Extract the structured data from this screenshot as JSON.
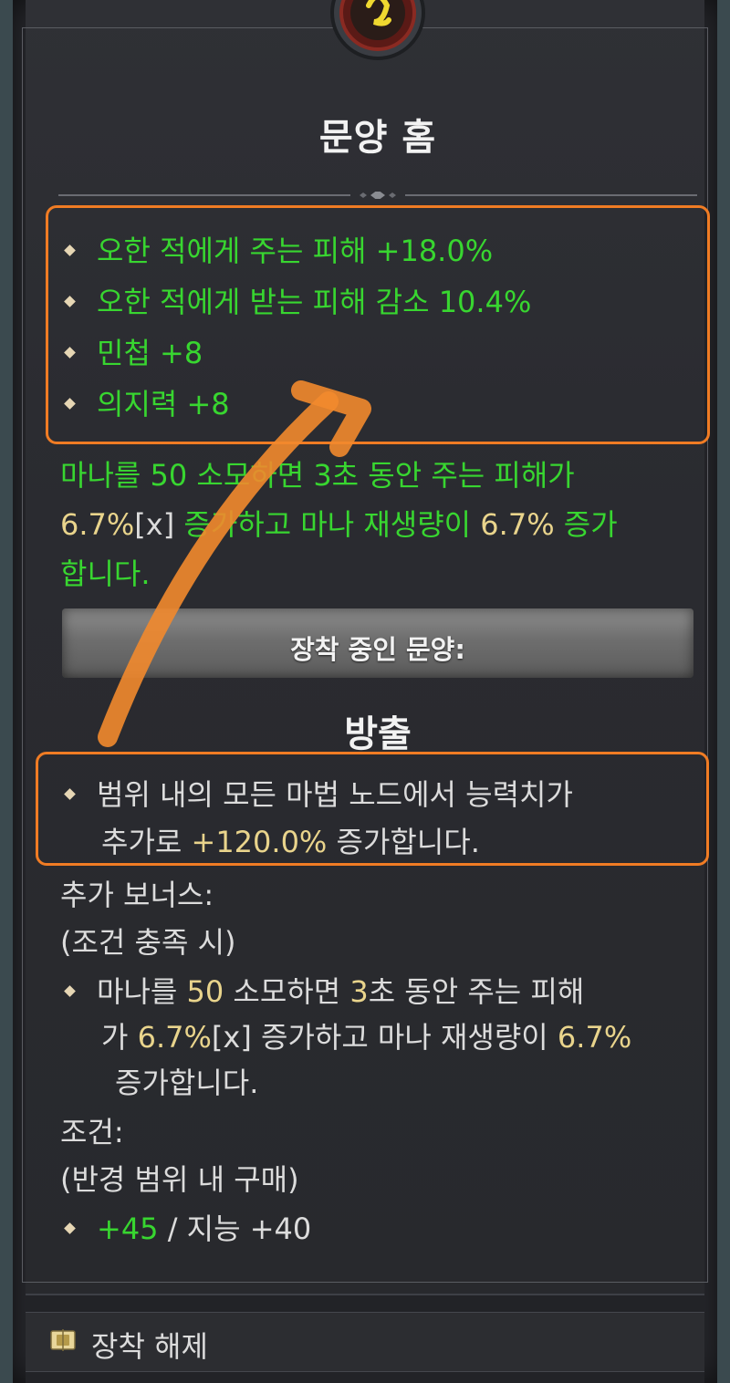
{
  "glyph": {
    "title": "문양 홈",
    "stats": [
      {
        "label": "오한 적에게 주는 피해 +18.0%"
      },
      {
        "label": "오한 적에게 받는 피해 감소 10.4%"
      },
      {
        "label": "민첩 +8"
      },
      {
        "label": "의지력 +8"
      }
    ],
    "magic_text": {
      "line1": "마나를 50 소모하면 3초 동안 주는 피해가",
      "line2_val": "6.7%",
      "line2_x": "[x]",
      "line2_mid": " 증가하고 마나 재생량이 ",
      "line2_val2": "6.7%",
      "line2_end": " 증가",
      "line3": "합니다."
    }
  },
  "equipped": {
    "banner": "장착 중인 문양:",
    "name": "방출",
    "effect": {
      "line1": "범위 내의 모든 마법 노드에서 능력치가",
      "line2_pre": "추가로 ",
      "line2_val": "+120.0%",
      "line2_post": " 증가합니다."
    },
    "additional_bonus": {
      "header": "추가 보너스:",
      "condition_note": "(조건 충족 시)",
      "text": {
        "l1_a": "마나를 ",
        "l1_b": "50",
        "l1_c": " 소모하면 ",
        "l1_d": "3",
        "l1_e": "초 동안 주는 피해",
        "l2_a": "가 ",
        "l2_b": "6.7%",
        "l2_x": "[x]",
        "l2_c": " 증가하고 마나 재생량이 ",
        "l2_d": "6.7%",
        "l3": "증가합니다."
      }
    },
    "requirement": {
      "header": "조건:",
      "note": "(반경 범위 내 구매)",
      "value_green": "+45",
      "value_rest": " / 지능 +40"
    }
  },
  "footer": {
    "unequip_label": "장착 해제",
    "unequip_icon": "unequip-glyph-icon"
  },
  "colors": {
    "accent_orange": "#f07c24",
    "stat_green": "#38d630",
    "value_yellow": "#e9d48c",
    "text_white": "#dcdcdc"
  }
}
